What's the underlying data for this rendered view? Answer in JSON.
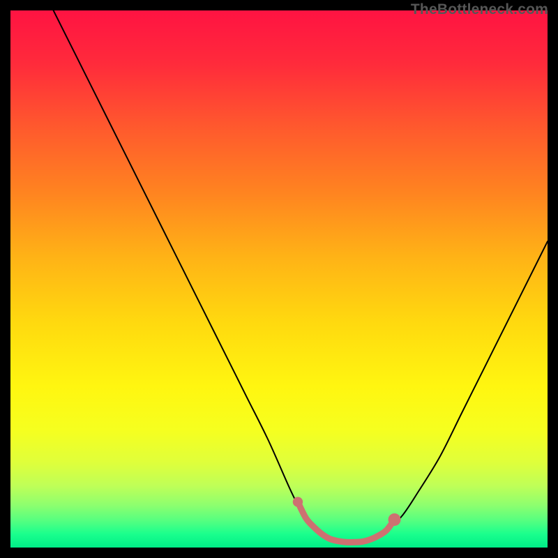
{
  "watermark": "TheBottleneck.com",
  "gradient_stops": [
    {
      "offset": 0.0,
      "color": "#ff1342"
    },
    {
      "offset": 0.1,
      "color": "#ff2b3b"
    },
    {
      "offset": 0.22,
      "color": "#ff5a2d"
    },
    {
      "offset": 0.34,
      "color": "#ff8420"
    },
    {
      "offset": 0.46,
      "color": "#ffb316"
    },
    {
      "offset": 0.58,
      "color": "#ffd90f"
    },
    {
      "offset": 0.7,
      "color": "#fff610"
    },
    {
      "offset": 0.78,
      "color": "#f6ff1f"
    },
    {
      "offset": 0.84,
      "color": "#e0ff3a"
    },
    {
      "offset": 0.885,
      "color": "#bfff57"
    },
    {
      "offset": 0.92,
      "color": "#8fff6e"
    },
    {
      "offset": 0.95,
      "color": "#55ff80"
    },
    {
      "offset": 0.975,
      "color": "#1aff8d"
    },
    {
      "offset": 1.0,
      "color": "#00ed87"
    }
  ],
  "chart_data": {
    "type": "line",
    "title": "",
    "xlabel": "",
    "ylabel": "",
    "xlim": [
      0,
      100
    ],
    "ylim": [
      0,
      100
    ],
    "grid": false,
    "series": [
      {
        "name": "bottleneck-curve",
        "x": [
          8,
          12,
          16,
          20,
          24,
          28,
          32,
          36,
          40,
          44,
          48,
          52,
          54,
          56,
          58,
          60,
          62,
          64,
          66,
          68,
          70,
          73,
          76,
          80,
          84,
          88,
          92,
          96,
          100
        ],
        "y": [
          100,
          92,
          84,
          76,
          68,
          60,
          52,
          44,
          36,
          28,
          20,
          11,
          7,
          4,
          2.3,
          1.4,
          1.0,
          1.0,
          1.2,
          1.8,
          3,
          6,
          10.5,
          17,
          25,
          33,
          41,
          49,
          57
        ],
        "color": "#000000",
        "width": 2.0
      }
    ],
    "highlight": {
      "name": "flat-region",
      "color": "#cd7171",
      "radius": 9,
      "line_width": 9,
      "x": [
        53.5,
        55,
        56.5,
        58,
        59.5,
        61,
        62.5,
        64,
        65.5,
        67,
        68.5,
        70.0,
        71.5
      ],
      "y": [
        8.5,
        5.5,
        3.8,
        2.5,
        1.6,
        1.2,
        1.0,
        1.0,
        1.1,
        1.5,
        2.2,
        3.2,
        5.2
      ]
    }
  }
}
